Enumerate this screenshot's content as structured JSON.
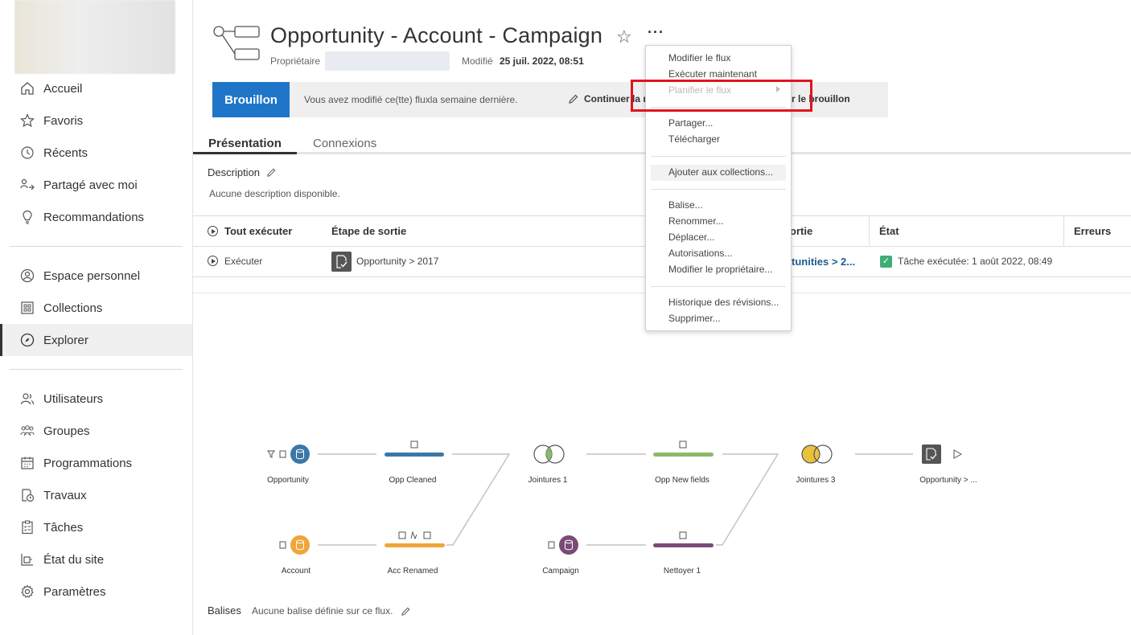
{
  "sidebar": {
    "items": [
      {
        "label": "Accueil",
        "icon": "home-icon"
      },
      {
        "label": "Favoris",
        "icon": "star-icon"
      },
      {
        "label": "Récents",
        "icon": "history-icon"
      },
      {
        "label": "Partagé avec moi",
        "icon": "shared-icon"
      },
      {
        "label": "Recommandations",
        "icon": "lightbulb-icon"
      },
      {
        "label": "Espace personnel",
        "icon": "user-circle-icon"
      },
      {
        "label": "Collections",
        "icon": "collections-icon"
      },
      {
        "label": "Explorer",
        "icon": "compass-icon"
      },
      {
        "label": "Utilisateurs",
        "icon": "users-icon"
      },
      {
        "label": "Groupes",
        "icon": "groups-icon"
      },
      {
        "label": "Programmations",
        "icon": "calendar-icon"
      },
      {
        "label": "Travaux",
        "icon": "jobs-icon"
      },
      {
        "label": "Tâches",
        "icon": "tasks-icon"
      },
      {
        "label": "État du site",
        "icon": "site-status-icon"
      },
      {
        "label": "Paramètres",
        "icon": "gear-icon"
      }
    ]
  },
  "header": {
    "title": "Opportunity - Account - Campaign",
    "owner_label": "Propriétaire",
    "modified_label": "Modifié",
    "modified_value": "25 juil. 2022, 08:51"
  },
  "banner": {
    "draft_label": "Brouillon",
    "message": "Vous avez modifié ce(tte) fluxla semaine dernière.",
    "continue_label": "Continuer la m",
    "publish_label": "ner le brouillon"
  },
  "tabs": [
    {
      "label": "Présentation"
    },
    {
      "label": "Connexions"
    }
  ],
  "description": {
    "label": "Description",
    "text": "Aucune description disponible."
  },
  "table": {
    "run_all": "Tout exécuter",
    "headers": [
      "Étape de sortie",
      "ortie",
      "État",
      "Erreurs"
    ],
    "row": {
      "run": "Exécuter",
      "step": "Opportunity > 2017",
      "output": "tunities > 2...",
      "state": "Tâche exécutée: 1 août 2022, 08:49"
    }
  },
  "menu": {
    "items": [
      {
        "label": "Modifier le flux",
        "disabled": false
      },
      {
        "label": "Exécuter maintenant",
        "disabled": false
      },
      {
        "label": "Planifier le flux",
        "disabled": true
      },
      {
        "label": "Partager...",
        "disabled": false
      },
      {
        "label": "Télécharger",
        "disabled": false
      },
      {
        "label": "Ajouter aux collections...",
        "disabled": false
      },
      {
        "label": "Balise...",
        "disabled": false
      },
      {
        "label": "Renommer...",
        "disabled": false
      },
      {
        "label": "Déplacer...",
        "disabled": false
      },
      {
        "label": "Autorisations...",
        "disabled": false
      },
      {
        "label": "Modifier le propriétaire...",
        "disabled": false
      },
      {
        "label": "Historique des révisions...",
        "disabled": false
      },
      {
        "label": "Supprimer...",
        "disabled": false
      }
    ]
  },
  "flow": {
    "nodes": {
      "opportunity": "Opportunity",
      "opp_cleaned": "Opp Cleaned",
      "jointures1": "Jointures 1",
      "opp_new_fields": "Opp New fields",
      "jointures3": "Jointures 3",
      "output": "Opportunity > ...",
      "account": "Account",
      "acc_renamed": "Acc Renamed",
      "campaign": "Campaign",
      "nettoyer1": "Nettoyer 1"
    }
  },
  "tags": {
    "label": "Balises",
    "text": "Aucune balise définie sur ce flux."
  },
  "colors": {
    "accent_blue": "#1f76c8",
    "link_blue": "#1f5c91",
    "input_blue": "#3b78a8",
    "input_orange": "#f0a43a",
    "input_purple": "#7a4b78",
    "clean_green": "#8cb96a",
    "join_yellow": "#e8c23a",
    "success_green": "#3fae76",
    "highlight_red": "#e0141e"
  }
}
